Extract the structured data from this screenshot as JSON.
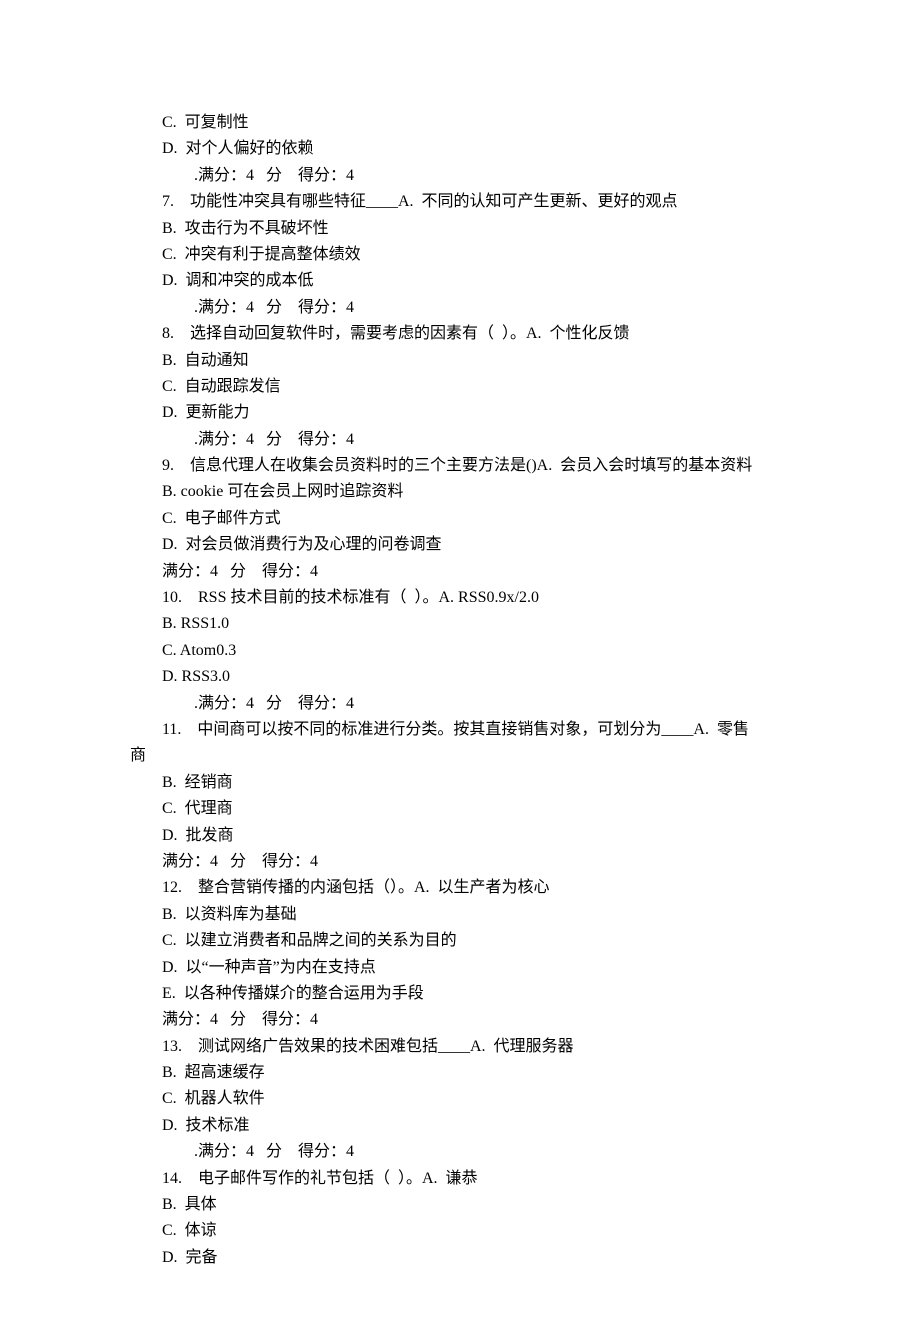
{
  "lines": [
    {
      "cls": "line",
      "key": "l1"
    },
    {
      "cls": "line",
      "key": "l2"
    },
    {
      "cls": "line score",
      "key": "l3"
    },
    {
      "cls": "line",
      "key": "l4"
    },
    {
      "cls": "line",
      "key": "l5"
    },
    {
      "cls": "line",
      "key": "l6"
    },
    {
      "cls": "line",
      "key": "l7"
    },
    {
      "cls": "line score",
      "key": "l8"
    },
    {
      "cls": "line",
      "key": "l9"
    },
    {
      "cls": "line",
      "key": "l10"
    },
    {
      "cls": "line",
      "key": "l11"
    },
    {
      "cls": "line",
      "key": "l12"
    },
    {
      "cls": "line score",
      "key": "l13"
    },
    {
      "cls": "line",
      "key": "l14"
    },
    {
      "cls": "line",
      "key": "l15"
    },
    {
      "cls": "line",
      "key": "l16"
    },
    {
      "cls": "line",
      "key": "l17"
    },
    {
      "cls": "line",
      "key": "l18"
    },
    {
      "cls": "line",
      "key": "l19"
    },
    {
      "cls": "line",
      "key": "l20"
    },
    {
      "cls": "line",
      "key": "l21"
    },
    {
      "cls": "line",
      "key": "l22"
    },
    {
      "cls": "line score",
      "key": "l23"
    },
    {
      "cls": "line",
      "key": "l24"
    },
    {
      "cls": "line noindent",
      "key": "l24b"
    },
    {
      "cls": "line",
      "key": "l25"
    },
    {
      "cls": "line",
      "key": "l26"
    },
    {
      "cls": "line",
      "key": "l27"
    },
    {
      "cls": "line",
      "key": "l28"
    },
    {
      "cls": "line",
      "key": "l29"
    },
    {
      "cls": "line",
      "key": "l30"
    },
    {
      "cls": "line",
      "key": "l31"
    },
    {
      "cls": "line",
      "key": "l32"
    },
    {
      "cls": "line",
      "key": "l33"
    },
    {
      "cls": "line",
      "key": "l34"
    },
    {
      "cls": "line",
      "key": "l35"
    },
    {
      "cls": "line",
      "key": "l36"
    },
    {
      "cls": "line",
      "key": "l37"
    },
    {
      "cls": "line",
      "key": "l38"
    },
    {
      "cls": "line score",
      "key": "l39"
    },
    {
      "cls": "line",
      "key": "l40"
    },
    {
      "cls": "line",
      "key": "l41"
    },
    {
      "cls": "line",
      "key": "l42"
    },
    {
      "cls": "line",
      "key": "l43"
    }
  ],
  "text": {
    "l1": "C.  可复制性",
    "l2": "D.  对个人偏好的依赖",
    "l3": ".满分：4   分    得分：4",
    "l4": "7.    功能性冲突具有哪些特征____A.  不同的认知可产生更新、更好的观点",
    "l5": "B.  攻击行为不具破坏性",
    "l6": "C.  冲突有利于提高整体绩效",
    "l7": "D.  调和冲突的成本低",
    "l8": ".满分：4   分    得分：4",
    "l9": "8.    选择自动回复软件时，需要考虑的因素有（  ）。A.  个性化反馈",
    "l10": "B.  自动通知",
    "l11": "C.  自动跟踪发信",
    "l12": "D.  更新能力",
    "l13": ".满分：4   分    得分：4",
    "l14": "9.    信息代理人在收集会员资料时的三个主要方法是()A.  会员入会时填写的基本资料",
    "l15": "B. cookie 可在会员上网时追踪资料",
    "l16": "C.  电子邮件方式",
    "l17": "D.  对会员做消费行为及心理的问卷调查",
    "l18": "满分：4   分    得分：4",
    "l19": "10.    RSS 技术目前的技术标准有（  ）。A. RSS0.9x/2.0",
    "l20": "B. RSS1.0",
    "l21": "C. Atom0.3",
    "l22": "D. RSS3.0",
    "l23": ".满分：4   分    得分：4",
    "l24": "11.    中间商可以按不同的标准进行分类。按其直接销售对象，可划分为____A.  零售",
    "l24b": "商",
    "l25": "B.  经销商",
    "l26": "C.  代理商",
    "l27": "D.  批发商",
    "l28": "满分：4   分    得分：4",
    "l29": "12.    整合营销传播的内涵包括（）。A.  以生产者为核心",
    "l30": "B.  以资料库为基础",
    "l31": "C.  以建立消费者和品牌之间的关系为目的",
    "l32": "D.  以“一种声音”为内在支持点",
    "l33": "E.  以各种传播媒介的整合运用为手段",
    "l34": "满分：4   分    得分：4",
    "l35": "13.    测试网络广告效果的技术困难包括____A.  代理服务器",
    "l36": "B.  超高速缓存",
    "l37": "C.  机器人软件",
    "l38": "D.  技术标准",
    "l39": ".满分：4   分    得分：4",
    "l40": "14.    电子邮件写作的礼节包括（  ）。A.  谦恭",
    "l41": "B.  具体",
    "l42": "C.  体谅",
    "l43": "D.  完备"
  }
}
